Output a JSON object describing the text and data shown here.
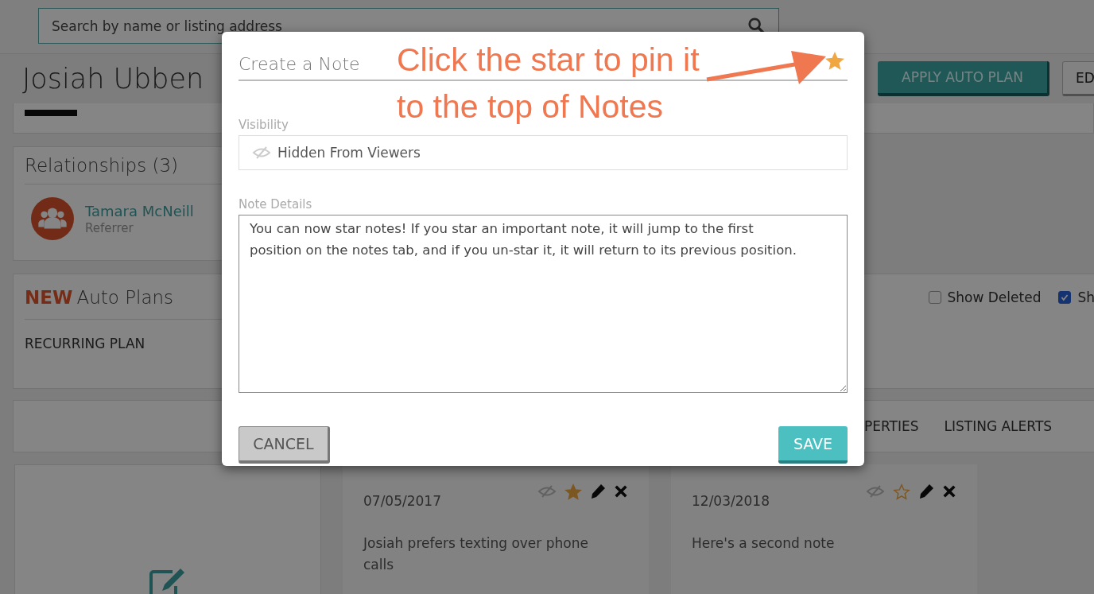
{
  "search": {
    "placeholder": "Search by name or listing address"
  },
  "contact": {
    "name": "Josiah Ubben"
  },
  "header_buttons": [
    {
      "label": "APPLY AUTO PLAN",
      "kind": "primary"
    },
    {
      "label": "ED",
      "kind": "secondary"
    }
  ],
  "relationships": {
    "title": "Relationships (3)",
    "people": [
      {
        "name": "Tamara McNeill",
        "role": "Referrer"
      }
    ]
  },
  "auto_plans": {
    "badge": "NEW",
    "title": "Auto Plans",
    "plans": [
      "RECURRING PLAN"
    ],
    "filters": [
      {
        "label": "Show Deleted",
        "checked": false
      },
      {
        "label": "Sh",
        "checked": true
      }
    ]
  },
  "tabs": [
    {
      "label": "PERTIES"
    },
    {
      "label": "LISTING ALERTS"
    }
  ],
  "notes": [
    {
      "date": "07/05/2017",
      "text": "Josiah prefers texting over phone calls",
      "starred": true
    },
    {
      "date": "12/03/2018",
      "text": "Here's a second note",
      "starred": false
    }
  ],
  "dialog": {
    "title": "Create a Note",
    "starred": true,
    "callout": "Click the star to pin it to the top of Notes",
    "visibility_label": "Visibility",
    "visibility": "Hidden From Viewers",
    "details_label": "Note Details",
    "details": "You can now star notes! If you star an important note, it will jump to the first position on the notes tab, and if you un-star it, it will return to its previous position.",
    "buttons": [
      {
        "label": "CANCEL",
        "kind": "cancel"
      },
      {
        "label": "SAVE",
        "kind": "save"
      }
    ]
  }
}
